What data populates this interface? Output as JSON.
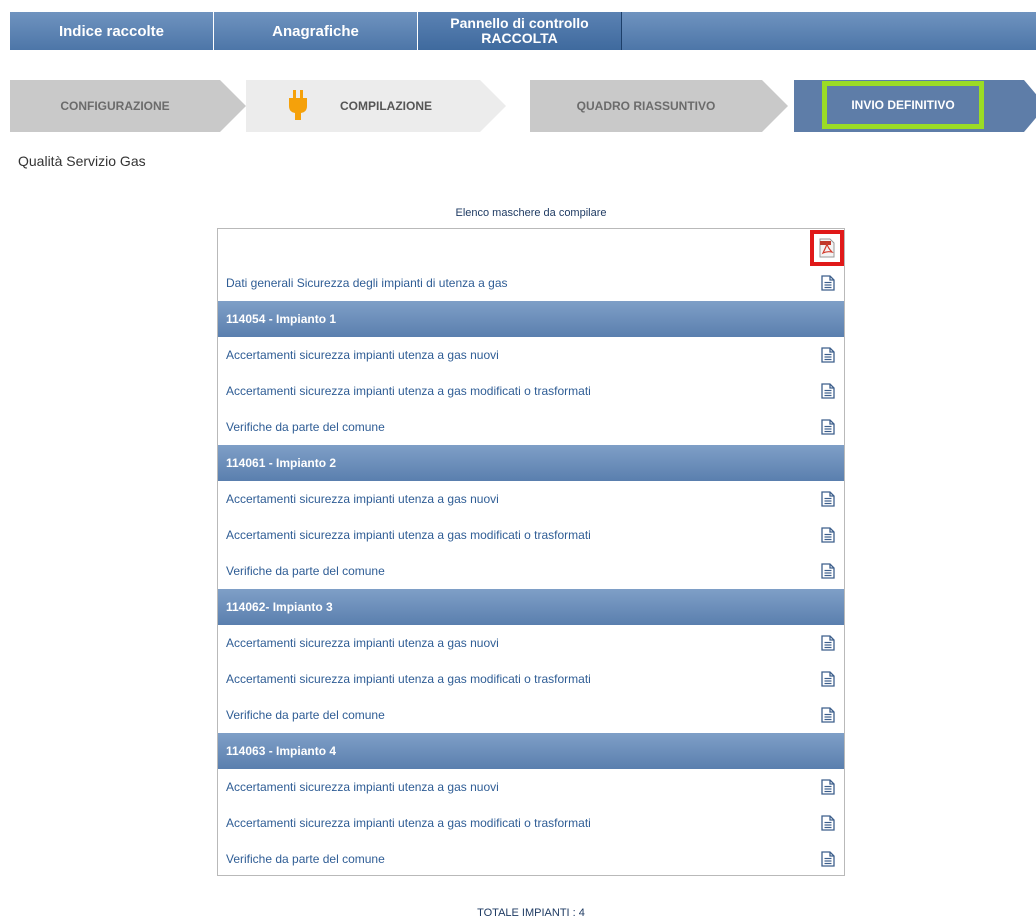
{
  "topnav": {
    "tabs": [
      {
        "label": "Indice raccolte"
      },
      {
        "label": "Anagrafiche"
      },
      {
        "label_line1": "Pannello di controllo",
        "label_line2": "RACCOLTA"
      }
    ]
  },
  "steps": {
    "configurazione": "CONFIGURAZIONE",
    "compilazione": "COMPILAZIONE",
    "quadro": "QUADRO RIASSUNTIVO",
    "invio": "INVIO DEFINITIVO"
  },
  "page": {
    "subtitle": "Qualità Servizio Gas",
    "list_title": "Elenco maschere da compilare",
    "total": "TOTALE IMPIANTI : 4"
  },
  "rows": [
    {
      "type": "link",
      "text": "Dati generali Sicurezza degli impianti di utenza a gas"
    },
    {
      "type": "header",
      "text": "114054 - Impianto 1"
    },
    {
      "type": "link",
      "text": "Accertamenti sicurezza impianti utenza a gas nuovi"
    },
    {
      "type": "link",
      "text": "Accertamenti sicurezza impianti utenza a gas modificati o trasformati"
    },
    {
      "type": "link",
      "text": "Verifiche da parte del comune"
    },
    {
      "type": "header",
      "text": "114061 - Impianto 2"
    },
    {
      "type": "link",
      "text": "Accertamenti sicurezza impianti utenza a gas nuovi"
    },
    {
      "type": "link",
      "text": "Accertamenti sicurezza impianti utenza a gas modificati o trasformati"
    },
    {
      "type": "link",
      "text": "Verifiche da parte del comune"
    },
    {
      "type": "header",
      "text": "114062- Impianto 3"
    },
    {
      "type": "link",
      "text": "Accertamenti sicurezza impianti utenza a gas nuovi"
    },
    {
      "type": "link",
      "text": "Accertamenti sicurezza impianti utenza a gas modificati o trasformati"
    },
    {
      "type": "link",
      "text": "Verifiche da parte del comune"
    },
    {
      "type": "header",
      "text": "114063 - Impianto 4"
    },
    {
      "type": "link",
      "text": "Accertamenti sicurezza impianti utenza a gas nuovi"
    },
    {
      "type": "link",
      "text": "Accertamenti sicurezza impianti utenza a gas modificati o trasformati"
    },
    {
      "type": "link",
      "text": "Verifiche da parte del comune"
    }
  ],
  "icons": {
    "pdf": "pdf-icon",
    "document": "document-icon",
    "plug": "plug-icon"
  },
  "colors": {
    "highlight_green": "#9bdc25",
    "highlight_red": "#e01919",
    "link_blue": "#2f5d95",
    "header_blue": "#5a7fae"
  }
}
